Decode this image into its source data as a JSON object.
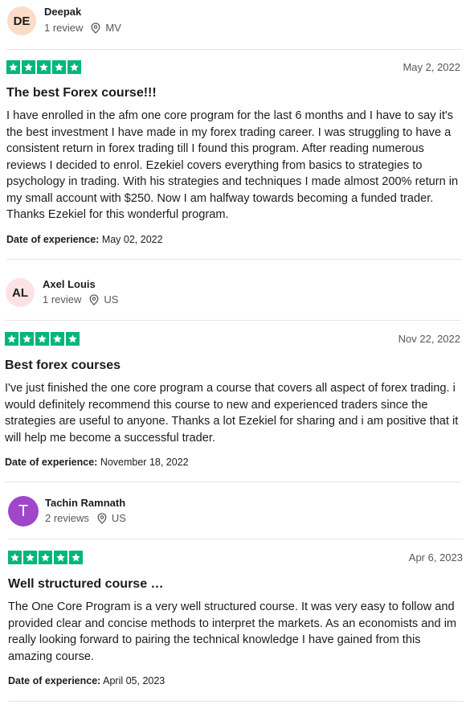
{
  "colors": {
    "star_green": "#00b67a",
    "avatar_de": "#fcdcc7",
    "avatar_al": "#fde2e4",
    "avatar_t": "#a046c9",
    "meta_gray": "#575757",
    "divider": "#e5e5dd"
  },
  "icons": {
    "location": "location-pin-icon",
    "star": "star-icon"
  },
  "reviews": [
    {
      "reviewer": {
        "initials": "DE",
        "name": "Deepak",
        "review_count": "1 review",
        "country": "MV"
      },
      "rating": 5,
      "date": "May 2, 2022",
      "title": "The best Forex course!!!",
      "body": "I have enrolled in the afm one core program for the last 6 months and I have to say it's the best investment I have made in my forex trading career. I was struggling to have a consistent return in forex trading till I found this program. After reading numerous reviews I decided to enrol. Ezekiel covers everything from basics to strategies to psychology in trading. With his strategies and techniques I made almost 200% return in my small account with $250. Now I am halfway towards becoming a funded trader. Thanks Ezekiel for this wonderful program.",
      "experience_label": "Date of experience:",
      "experience_date": "May 02, 2022"
    },
    {
      "reviewer": {
        "initials": "AL",
        "name": "Axel Louis",
        "review_count": "1 review",
        "country": "US"
      },
      "rating": 5,
      "date": "Nov 22, 2022",
      "title": "Best forex courses",
      "body": "I've just finished the one core program a course that covers all aspect of forex trading. i would definitely recommend this course to new and experienced traders since the strategies are useful to anyone. Thanks a lot Ezekiel for sharing and i am positive that it will help me become a successful trader.",
      "experience_label": "Date of experience:",
      "experience_date": "November 18, 2022"
    },
    {
      "reviewer": {
        "initials": "T",
        "name": "Tachin Ramnath",
        "review_count": "2 reviews",
        "country": "US"
      },
      "rating": 5,
      "date": "Apr 6, 2023",
      "title": "Well structured course …",
      "body": "The One Core Program is a very well structured course. It was very easy to follow and provided clear and concise methods to interpret the markets. As an economists and im really looking forward to pairing the technical knowledge I have gained from this amazing course.",
      "experience_label": "Date of experience:",
      "experience_date": "April 05, 2023"
    }
  ]
}
